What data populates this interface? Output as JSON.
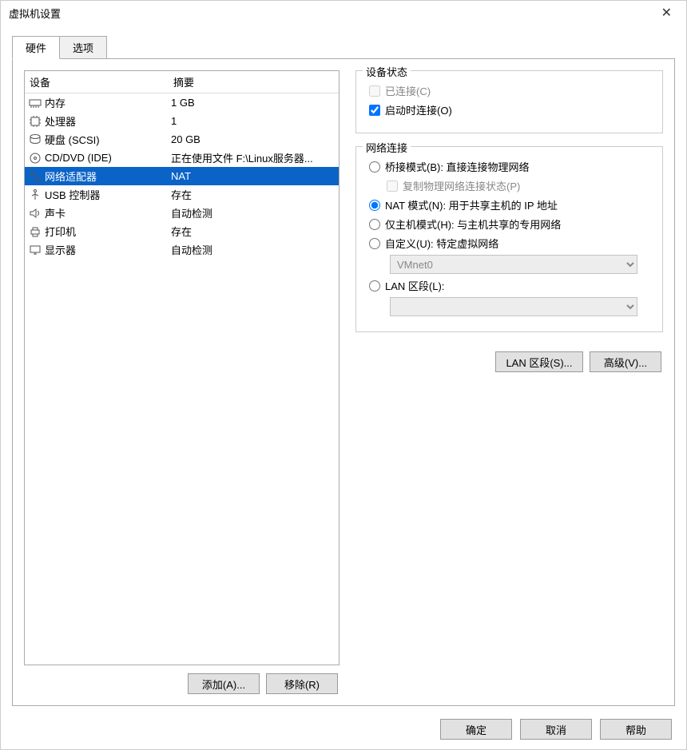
{
  "window": {
    "title": "虚拟机设置"
  },
  "tabs": {
    "hardware": "硬件",
    "options": "选项"
  },
  "list": {
    "header": {
      "device": "设备",
      "summary": "摘要"
    },
    "rows": [
      {
        "device": "内存",
        "summary": "1 GB",
        "icon": "mem"
      },
      {
        "device": "处理器",
        "summary": "1",
        "icon": "cpu"
      },
      {
        "device": "硬盘 (SCSI)",
        "summary": "20 GB",
        "icon": "hdd"
      },
      {
        "device": "CD/DVD (IDE)",
        "summary": "正在使用文件 F:\\Linux服务器...",
        "icon": "cd"
      },
      {
        "device": "网络适配器",
        "summary": "NAT",
        "icon": "net"
      },
      {
        "device": "USB 控制器",
        "summary": "存在",
        "icon": "usb"
      },
      {
        "device": "声卡",
        "summary": "自动检测",
        "icon": "snd"
      },
      {
        "device": "打印机",
        "summary": "存在",
        "icon": "prn"
      },
      {
        "device": "显示器",
        "summary": "自动检测",
        "icon": "disp"
      }
    ]
  },
  "leftButtons": {
    "add": "添加(A)...",
    "remove": "移除(R)"
  },
  "status": {
    "legend": "设备状态",
    "connected": "已连接(C)",
    "connectOnPower": "启动时连接(O)"
  },
  "net": {
    "legend": "网络连接",
    "bridge": "桥接模式(B): 直接连接物理网络",
    "replicate": "复制物理网络连接状态(P)",
    "nat": "NAT 模式(N): 用于共享主机的 IP 地址",
    "host": "仅主机模式(H): 与主机共享的专用网络",
    "custom": "自定义(U): 特定虚拟网络",
    "customSelect": "VMnet0",
    "lan": "LAN 区段(L):",
    "lanSelect": ""
  },
  "rightButtons": {
    "lan": "LAN 区段(S)...",
    "adv": "高级(V)..."
  },
  "footer": {
    "ok": "确定",
    "cancel": "取消",
    "help": "帮助"
  }
}
